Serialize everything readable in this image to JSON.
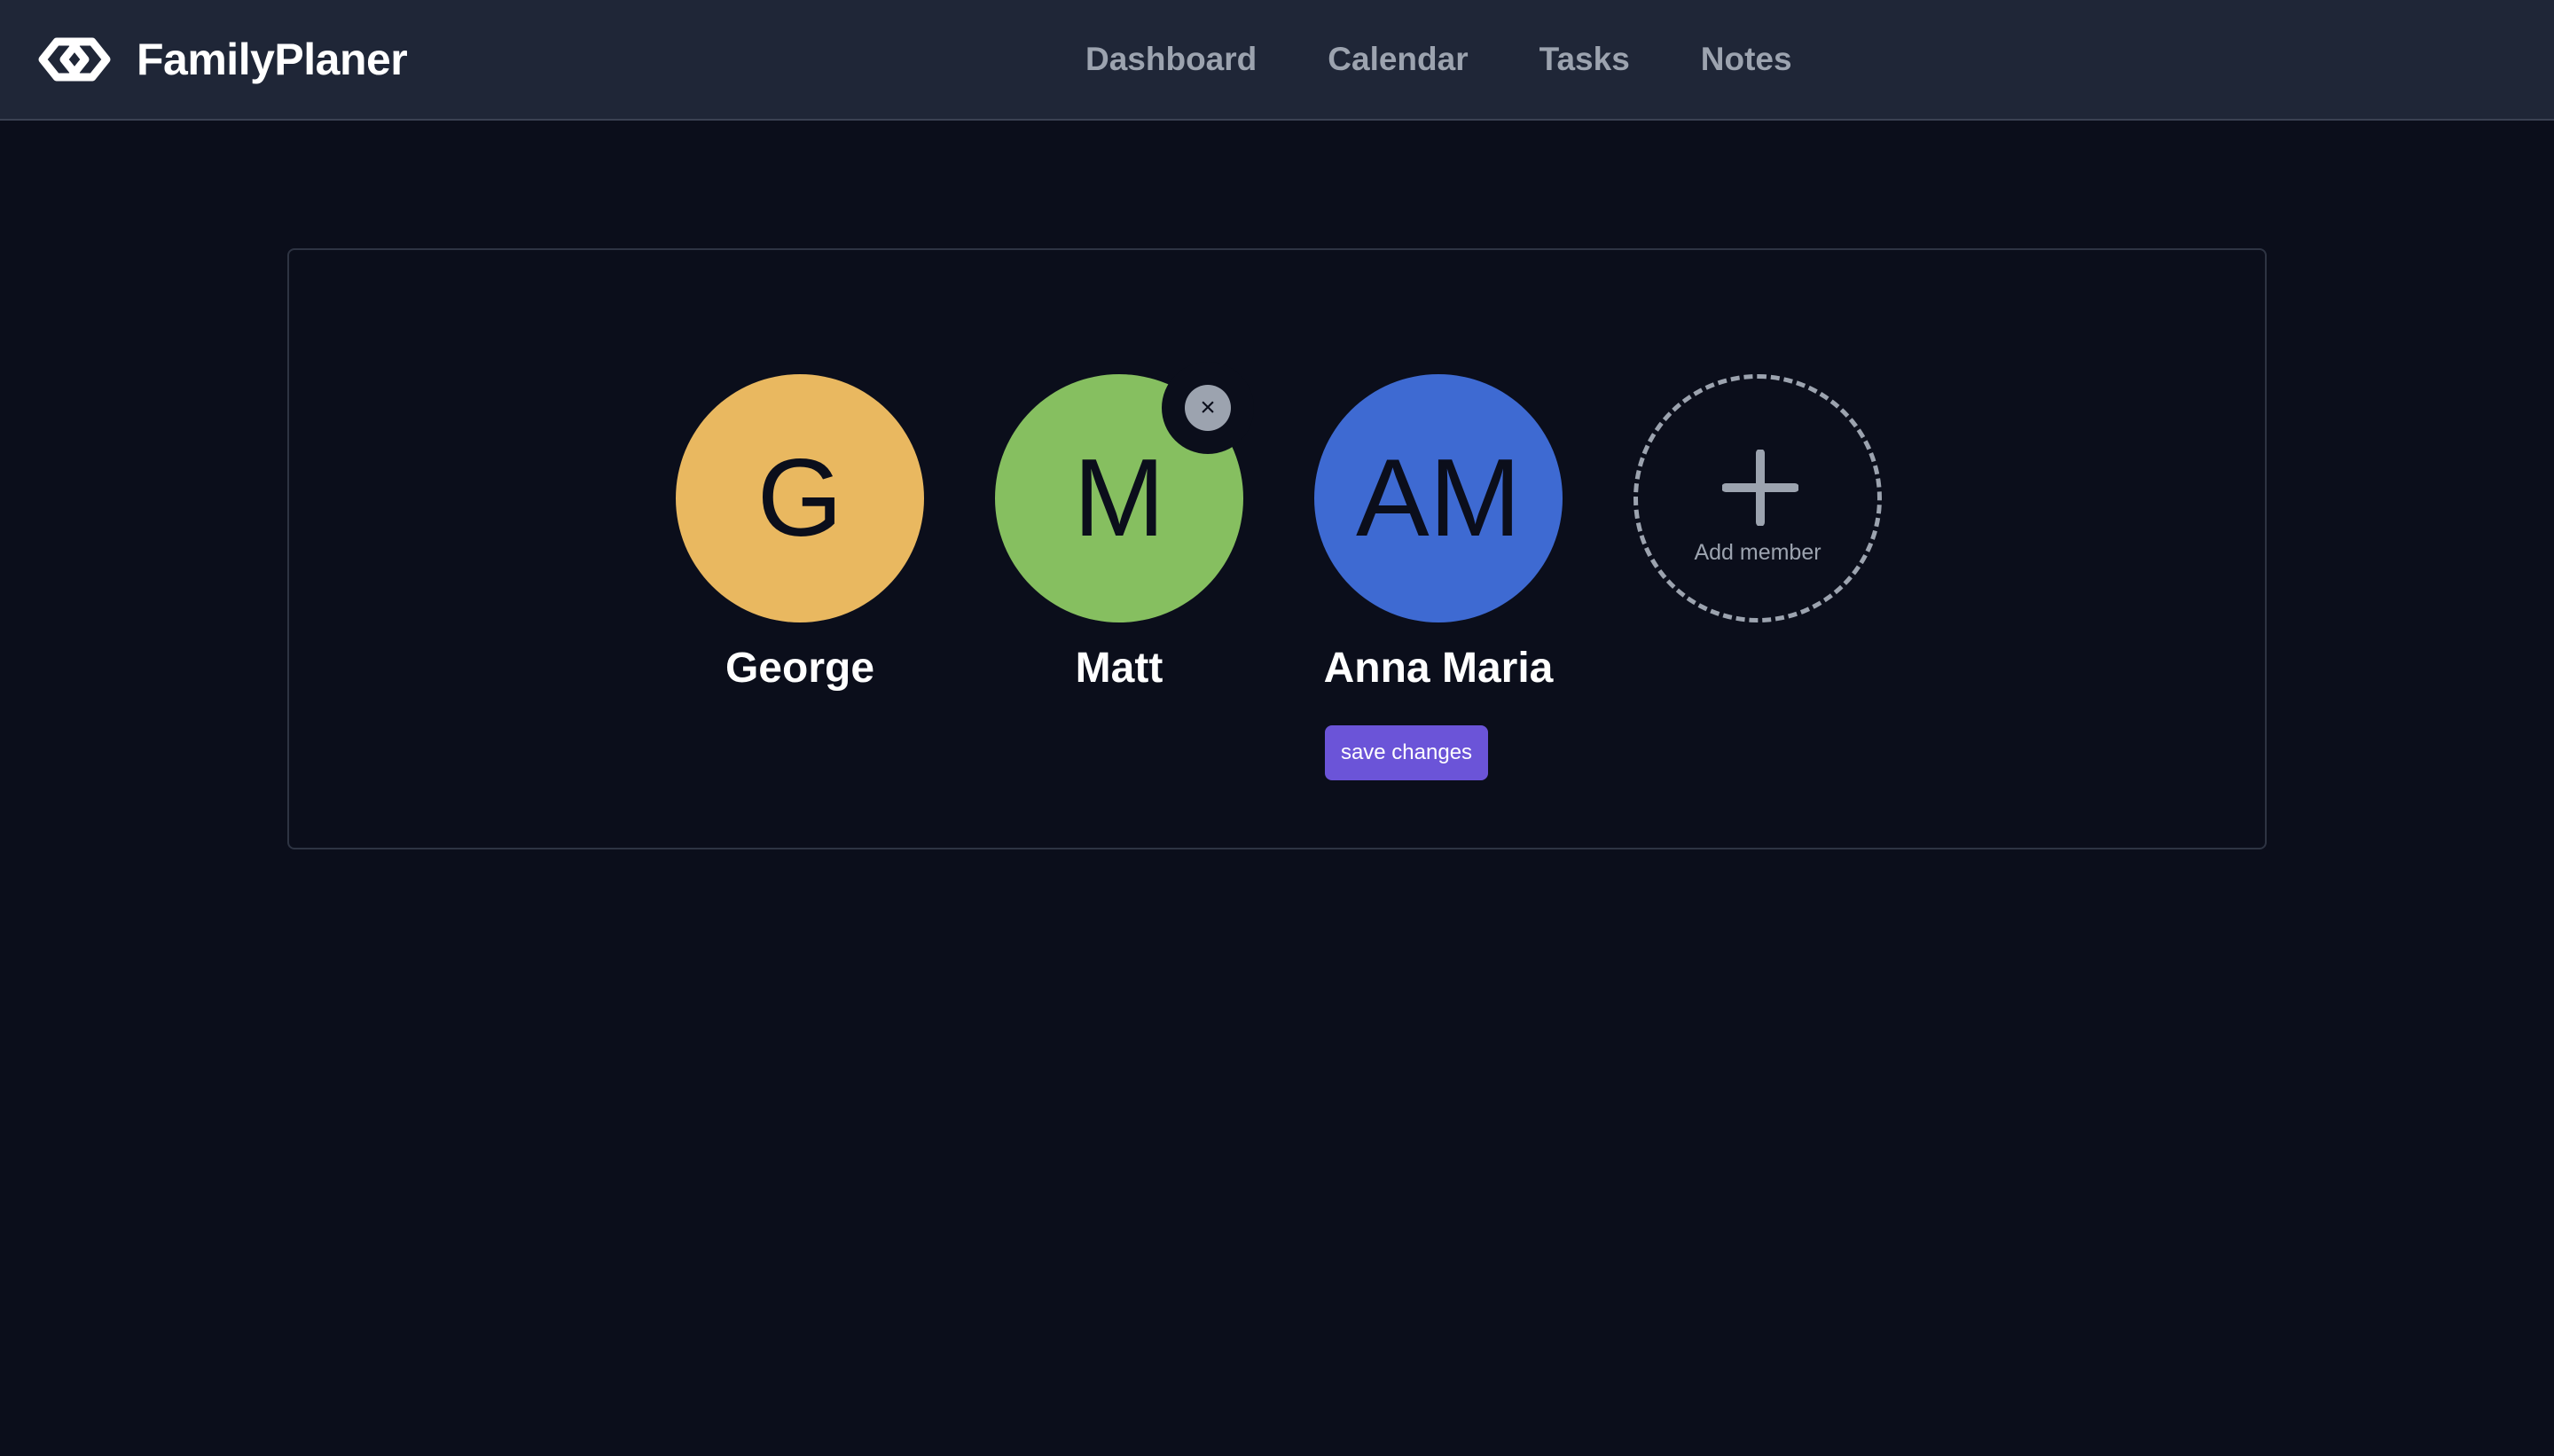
{
  "app": {
    "name": "FamilyPlaner",
    "logo_icon": "infinity-link-icon"
  },
  "nav": {
    "items": [
      {
        "label": "Dashboard"
      },
      {
        "label": "Calendar"
      },
      {
        "label": "Tasks"
      },
      {
        "label": "Notes"
      }
    ]
  },
  "members": [
    {
      "initials": "G",
      "name": "George",
      "color": "#e9b860"
    },
    {
      "initials": "M",
      "name": "Matt",
      "color": "#86bf60",
      "remove_icon": "close-icon",
      "remove_label": "×"
    },
    {
      "initials": "AM",
      "name": "Anna Maria",
      "color": "#3e6ad2"
    }
  ],
  "actions": {
    "save_label": "save changes",
    "add_member_label": "Add member",
    "add_icon": "plus-icon"
  },
  "colors": {
    "background": "#0b0e1b",
    "navbar": "#1f2637",
    "accent": "#6b54d8",
    "muted": "#9ca3af"
  }
}
